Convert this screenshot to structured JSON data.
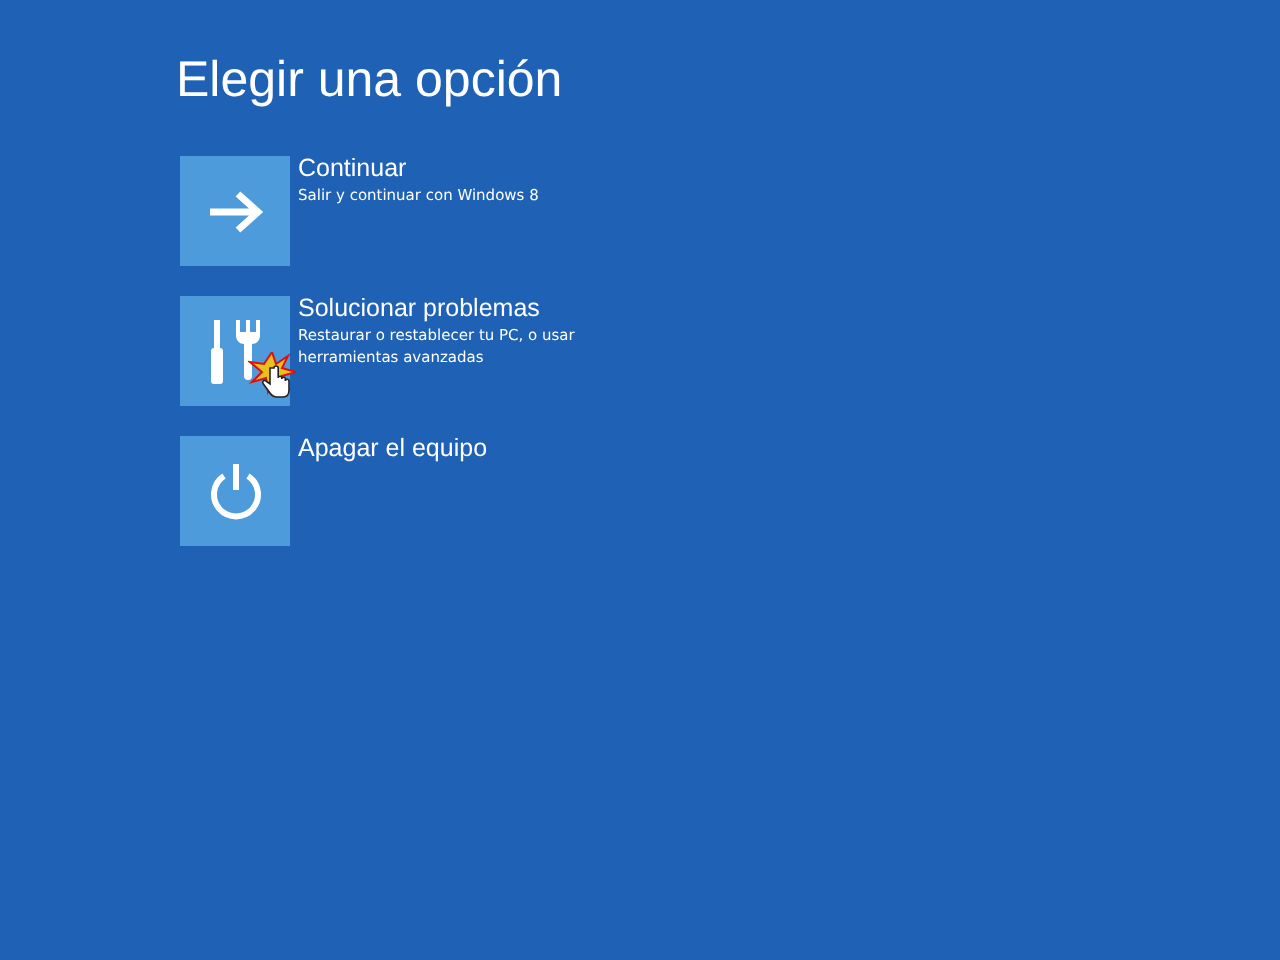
{
  "title": "Elegir una opción",
  "options": [
    {
      "kind": "arrow",
      "label": "Continuar",
      "description": "Salir y continuar con Windows 8"
    },
    {
      "kind": "tools",
      "label": "Solucionar problemas",
      "description": "Restaurar o restablecer tu PC, o usar herramientas avanzadas"
    },
    {
      "kind": "power",
      "label": "Apagar el equipo"
    }
  ]
}
